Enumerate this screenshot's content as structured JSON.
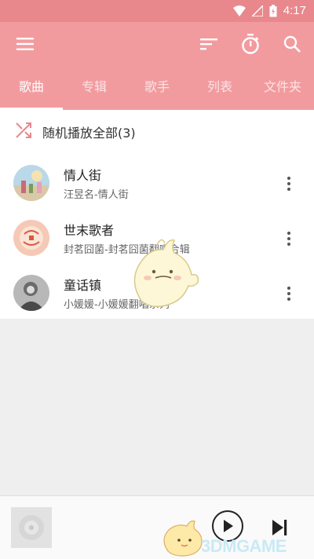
{
  "status_bar": {
    "time": "4:17"
  },
  "tabs": [
    {
      "label": "歌曲",
      "active": true
    },
    {
      "label": "专辑",
      "active": false
    },
    {
      "label": "歌手",
      "active": false
    },
    {
      "label": "列表",
      "active": false
    },
    {
      "label": "文件夹",
      "active": false
    }
  ],
  "shuffle": {
    "label": "随机播放全部(3)"
  },
  "songs": [
    {
      "title": "情人街",
      "subtitle": "汪昱名-情人街"
    },
    {
      "title": "世末歌者",
      "subtitle": "封茗囧菌-封茗囧菌翻唱合辑"
    },
    {
      "title": "童话镇",
      "subtitle": "小媛媛-小媛媛翻唱系列"
    }
  ],
  "watermark": "3DMGAME",
  "colors": {
    "toolbar": "#f29b9f",
    "statusbar": "#e8888c",
    "background": "#efefef"
  }
}
